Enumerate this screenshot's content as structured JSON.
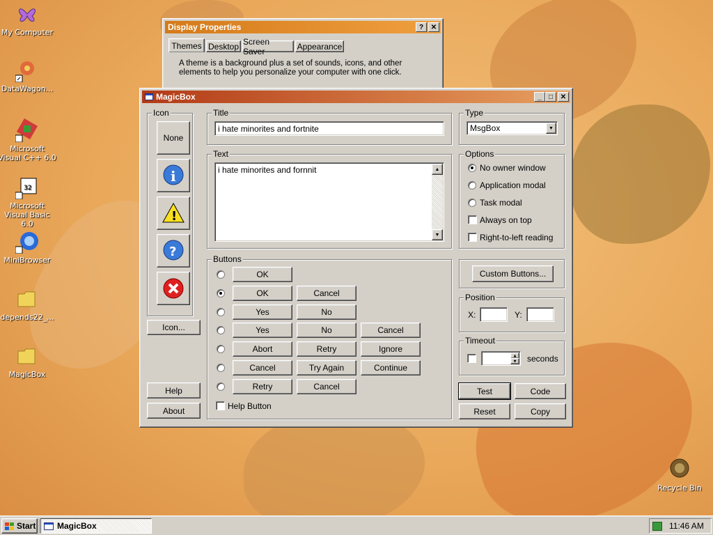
{
  "desktop": {
    "icons": [
      {
        "label": "My Computer"
      },
      {
        "label": "DataWagon..."
      },
      {
        "label": "Microsoft Visual C++ 6.0"
      },
      {
        "label": "Microsoft Visual Basic 6.0"
      },
      {
        "label": "MiniBrowser"
      },
      {
        "label": "depends22_..."
      },
      {
        "label": "MagicBox"
      }
    ],
    "recycle": "Recycle Bin"
  },
  "display": {
    "title": "Display Properties",
    "tabs": [
      "Themes",
      "Desktop",
      "Screen Saver",
      "Appearance"
    ],
    "text": "A theme is a background plus a set of sounds, icons, and other elements to help you personalize your computer with one click."
  },
  "magic": {
    "title": "MagicBox",
    "icon_group": "Icon",
    "none_label": "None",
    "icon_btn": "Icon...",
    "help_btn": "Help",
    "about_btn": "About",
    "title_group": "Title",
    "title_value": "i hate minorites and fortnite",
    "text_group": "Text",
    "text_value": "i hate minorites and fornnit",
    "buttons_group": "Buttons",
    "button_rows": [
      [
        "OK"
      ],
      [
        "OK",
        "Cancel"
      ],
      [
        "Yes",
        "No"
      ],
      [
        "Yes",
        "No",
        "Cancel"
      ],
      [
        "Abort",
        "Retry",
        "Ignore"
      ],
      [
        "Cancel",
        "Try Again",
        "Continue"
      ],
      [
        "Retry",
        "Cancel"
      ]
    ],
    "help_button_check": "Help Button",
    "type_group": "Type",
    "type_value": "MsgBox",
    "options_group": "Options",
    "options": [
      "No owner window",
      "Application modal",
      "Task modal",
      "Always on top",
      "Right-to-left reading"
    ],
    "custom_buttons": "Custom Buttons...",
    "position_group": "Position",
    "x_label": "X:",
    "y_label": "Y:",
    "timeout_group": "Timeout",
    "seconds": "seconds",
    "test": "Test",
    "code": "Code",
    "reset": "Reset",
    "copy": "Copy"
  },
  "taskbar": {
    "start": "Start",
    "task": "MagicBox",
    "time": "11:46 AM"
  },
  "colors": {
    "titlebar_start": "#b23a16",
    "titlebar_end": "#e8a060",
    "classic_face": "#d4d0c8"
  }
}
